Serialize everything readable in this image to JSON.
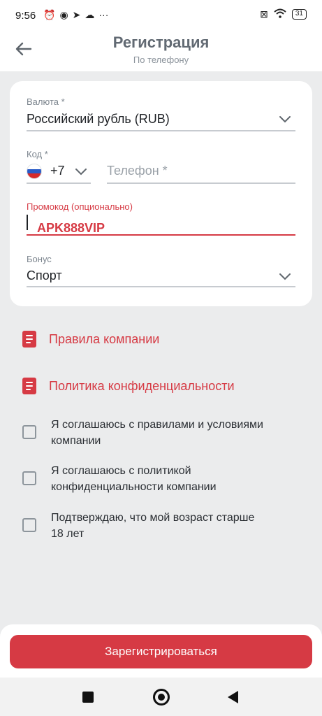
{
  "status_bar": {
    "time": "9:56",
    "battery": "31",
    "left_icons": [
      "alarm-off-icon",
      "whatsapp-icon",
      "telegram-icon",
      "cloud-icon",
      "more-dots-icon"
    ],
    "right_icons": [
      "sim-off-icon",
      "wifi-icon",
      "battery-icon"
    ]
  },
  "header": {
    "title": "Регистрация",
    "subtitle": "По телефону"
  },
  "form": {
    "currency": {
      "label": "Валюта *",
      "value": "Российский рубль (RUB)"
    },
    "code": {
      "label": "Код *",
      "value": "+7"
    },
    "phone": {
      "placeholder": "Телефон *"
    },
    "promo": {
      "label": "Промокод (опционально)",
      "value": "APK888VIP"
    },
    "bonus": {
      "label": "Бонус",
      "value": "Спорт"
    }
  },
  "links": [
    {
      "label": "Правила компании"
    },
    {
      "label": "Политика конфиденциальности"
    }
  ],
  "agreements": [
    {
      "line1": "Я соглашаюсь с правилами и условиями",
      "line2": "компании",
      "checked": false
    },
    {
      "line1": "Я соглашаюсь с политикой",
      "line2": "конфиденциальности компании",
      "checked": false
    },
    {
      "line1": "Подтверждаю, что мой возраст старше",
      "line2": "18 лет",
      "checked": false
    }
  ],
  "register_button": {
    "label": "Зарегистрироваться"
  },
  "colors": {
    "accent": "#d63a44",
    "background": "#ebeced",
    "card": "#ffffff"
  }
}
